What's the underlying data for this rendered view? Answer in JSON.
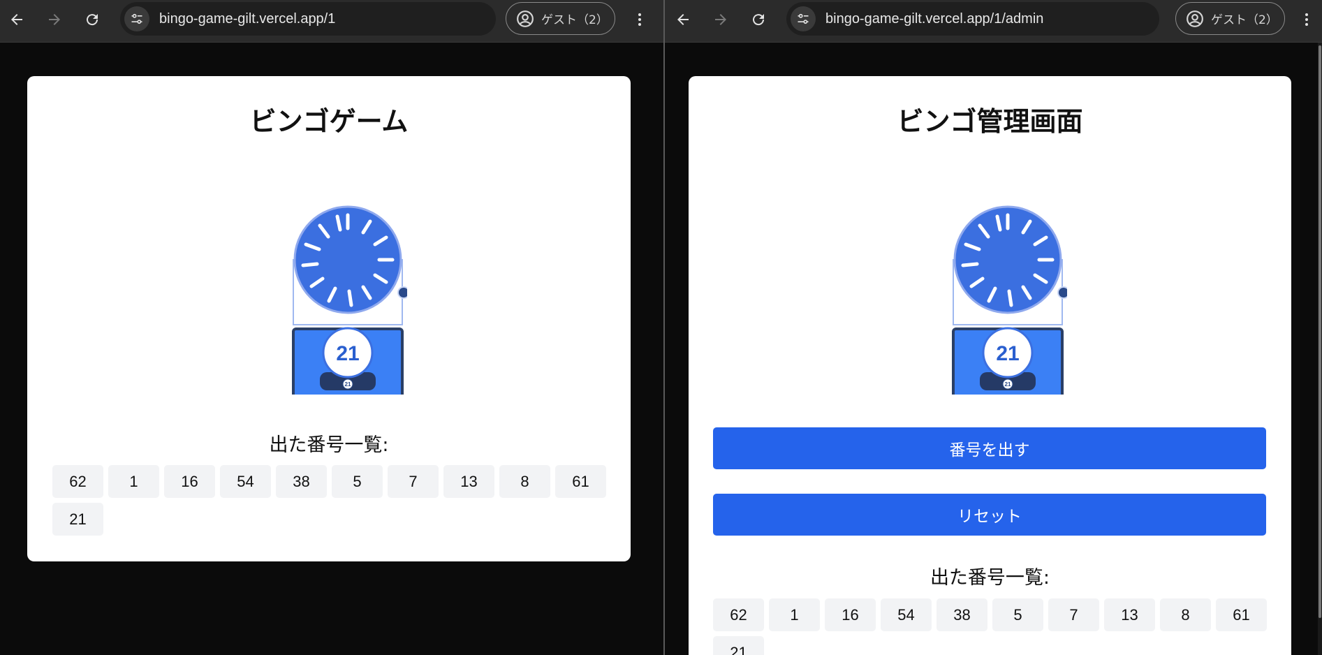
{
  "colors": {
    "primary_button": "#2563eb",
    "machine_blue": "#3b6fe0",
    "toolbar_bg": "#2b2b2b"
  },
  "left_window": {
    "url": "bingo-game-gilt.vercel.app/1",
    "profile_label": "ゲスト（2）",
    "page": {
      "title": "ビンゴゲーム",
      "current_number": "21",
      "history_title": "出た番号一覧:",
      "drawn_numbers": [
        "62",
        "1",
        "16",
        "54",
        "38",
        "5",
        "7",
        "13",
        "8",
        "61",
        "21"
      ]
    }
  },
  "right_window": {
    "url": "bingo-game-gilt.vercel.app/1/admin",
    "profile_label": "ゲスト（2）",
    "page": {
      "title": "ビンゴ管理画面",
      "current_number": "21",
      "draw_button_label": "番号を出す",
      "reset_button_label": "リセット",
      "history_title": "出た番号一覧:",
      "drawn_numbers": [
        "62",
        "1",
        "16",
        "54",
        "38",
        "5",
        "7",
        "13",
        "8",
        "61",
        "21"
      ]
    }
  },
  "icons": {
    "back": "arrow-left-icon",
    "forward": "arrow-right-icon",
    "reload": "reload-icon",
    "site_info": "tune-icon",
    "profile": "account-circle-icon",
    "menu": "more-vertical-icon"
  }
}
